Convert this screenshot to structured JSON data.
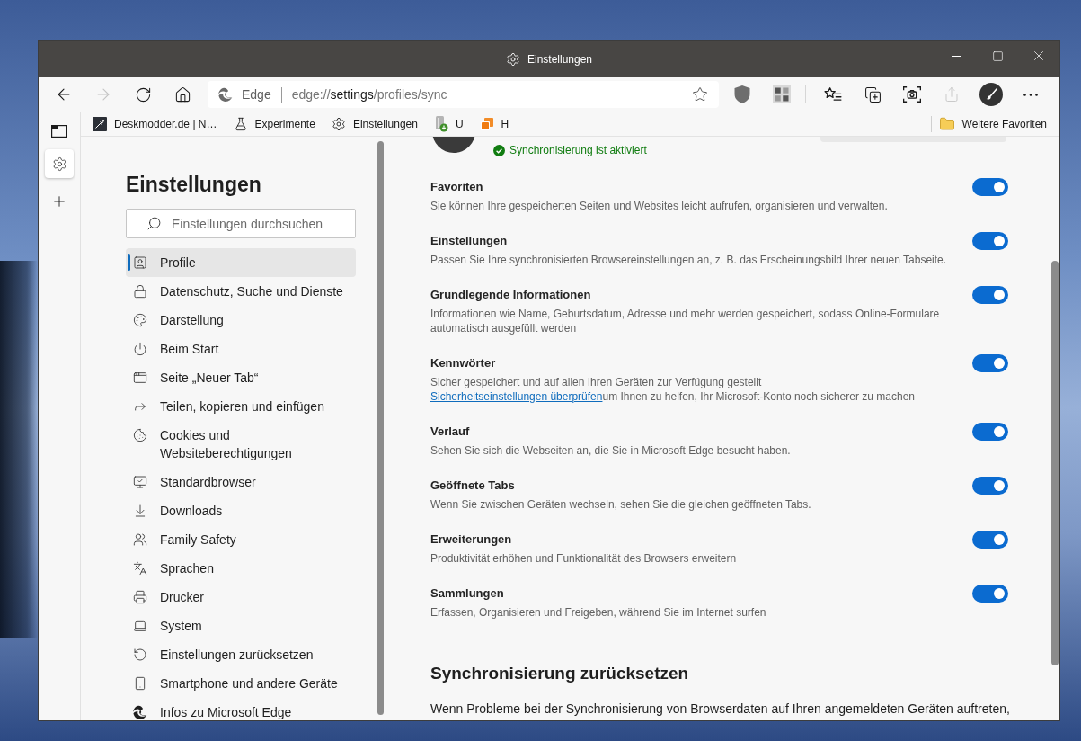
{
  "window": {
    "title": "Einstellungen"
  },
  "toolbar": {
    "forward_disabled": true,
    "share_disabled": true,
    "site_label": "Edge",
    "url": {
      "scheme": "edge://",
      "host": "settings",
      "path": "/profiles/sync"
    }
  },
  "favorites_bar": {
    "items": [
      {
        "kind": "site",
        "label": "Deskmodder.de | N…"
      },
      {
        "kind": "flask",
        "label": "Experimente"
      },
      {
        "kind": "gear",
        "label": "Einstellungen"
      },
      {
        "kind": "extension",
        "label": "U"
      },
      {
        "kind": "squares",
        "label": "H"
      }
    ],
    "folder": "Weitere Favoriten"
  },
  "settings_nav": {
    "title": "Einstellungen",
    "search_placeholder": "Einstellungen durchsuchen",
    "items": [
      {
        "kind": "profile",
        "label": "Profile",
        "selected": true
      },
      {
        "kind": "privacy",
        "label": "Datenschutz, Suche und Dienste",
        "selected": false
      },
      {
        "kind": "appearance",
        "label": "Darstellung",
        "selected": false
      },
      {
        "kind": "startup",
        "label": "Beim Start",
        "selected": false
      },
      {
        "kind": "newtab",
        "label": "Seite „Neuer Tab“",
        "selected": false
      },
      {
        "kind": "sharing",
        "label": "Teilen, kopieren und einfügen",
        "selected": false
      },
      {
        "kind": "cookies",
        "label": "Cookies und Websiteberechtigungen",
        "selected": false
      },
      {
        "kind": "browser",
        "label": "Standardbrowser",
        "selected": false
      },
      {
        "kind": "downloads",
        "label": "Downloads",
        "selected": false
      },
      {
        "kind": "family",
        "label": "Family Safety",
        "selected": false
      },
      {
        "kind": "languages",
        "label": "Sprachen",
        "selected": false
      },
      {
        "kind": "printer",
        "label": "Drucker",
        "selected": false
      },
      {
        "kind": "system",
        "label": "System",
        "selected": false
      },
      {
        "kind": "reset",
        "label": "Einstellungen zurücksetzen",
        "selected": false
      },
      {
        "kind": "phone",
        "label": "Smartphone und andere Geräte",
        "selected": false
      },
      {
        "kind": "about",
        "label": "Infos zu Microsoft Edge",
        "selected": false
      }
    ]
  },
  "sync": {
    "status": "Synchronisierung ist aktiviert",
    "items": [
      {
        "title": "Favoriten",
        "description": "Sie können Ihre gespeicherten Seiten und Websites leicht aufrufen, organisieren und verwalten.",
        "on": true
      },
      {
        "title": "Einstellungen",
        "description": "Passen Sie Ihre synchronisierten Browsereinstellungen an, z. B. das Erscheinungsbild Ihrer neuen Tabseite.",
        "on": true
      },
      {
        "title": "Grundlegende Informationen",
        "description": "Informationen wie Name, Geburtsdatum, Adresse und mehr werden gespeichert, sodass Online-Formulare automatisch ausgefüllt werden",
        "on": true
      },
      {
        "title": "Kennwörter",
        "description": "Sicher gespeichert und auf allen Ihren Geräten zur Verfügung gestellt",
        "link": "Sicherheitseinstellungen überprüfen",
        "after_link": "um Ihnen zu helfen, Ihr Microsoft-Konto noch sicherer zu machen",
        "on": true
      },
      {
        "title": "Verlauf",
        "description": "Sehen Sie sich die Webseiten an, die Sie in Microsoft Edge besucht haben.",
        "on": true
      },
      {
        "title": "Geöffnete Tabs",
        "description": "Wenn Sie zwischen Geräten wechseln, sehen Sie die gleichen geöffneten Tabs.",
        "on": true
      },
      {
        "title": "Erweiterungen",
        "description": "Produktivität erhöhen und Funktionalität des Browsers erweitern",
        "on": true
      },
      {
        "title": "Sammlungen",
        "description": "Erfassen, Organisieren und Freigeben, während Sie im Internet surfen",
        "on": true
      }
    ],
    "reset": {
      "title": "Synchronisierung zurücksetzen",
      "text": "Wenn Probleme bei der Synchronisierung von Browserdaten auf Ihren angemeldeten Geräten auftreten,"
    }
  }
}
